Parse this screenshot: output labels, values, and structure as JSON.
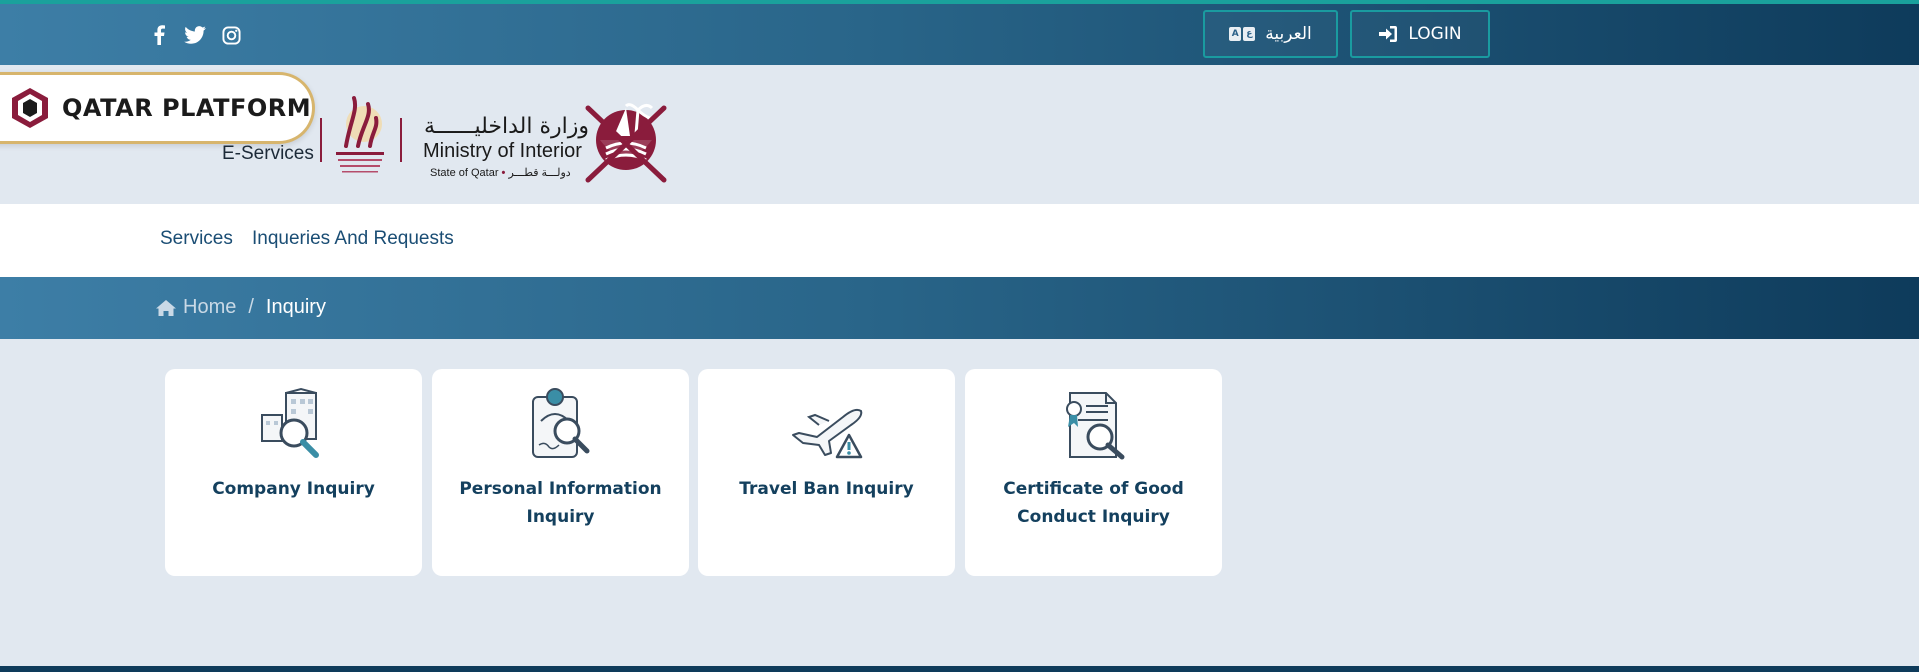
{
  "topbar": {
    "social": [
      {
        "icon": "facebook-icon"
      },
      {
        "icon": "twitter-icon"
      },
      {
        "icon": "instagram-icon"
      }
    ],
    "language_label": "العربية",
    "login_label": "LOGIN"
  },
  "header": {
    "platform_logo_text": "QATAR PLATFORM",
    "eservices_label": "E-Services",
    "moi_arabic": "وزارة الداخليــــــة",
    "moi_english": "Ministry of Interior",
    "moi_state_en": "State of Qatar",
    "moi_state_ar": "دولـــة قطـــر"
  },
  "nav": {
    "items": [
      {
        "label": "Services"
      },
      {
        "label": "Inqueries And Requests"
      }
    ]
  },
  "breadcrumb": {
    "home_label": "Home",
    "separator": "/",
    "current_label": "Inquiry"
  },
  "cards": [
    {
      "title": "Company Inquiry",
      "icon": "company-search-icon"
    },
    {
      "title": "Personal Information Inquiry",
      "icon": "person-search-icon"
    },
    {
      "title": "Travel Ban Inquiry",
      "icon": "airplane-warning-icon"
    },
    {
      "title": "Certificate of Good Conduct Inquiry",
      "icon": "certificate-search-icon"
    }
  ],
  "colors": {
    "header_gradient_start": "#3d7ea6",
    "header_gradient_end": "#0e3b5b",
    "accent_teal": "#1aa19c",
    "page_bg": "#e1e8f0",
    "card_title": "#14405e",
    "maroon": "#8a1c3c"
  }
}
